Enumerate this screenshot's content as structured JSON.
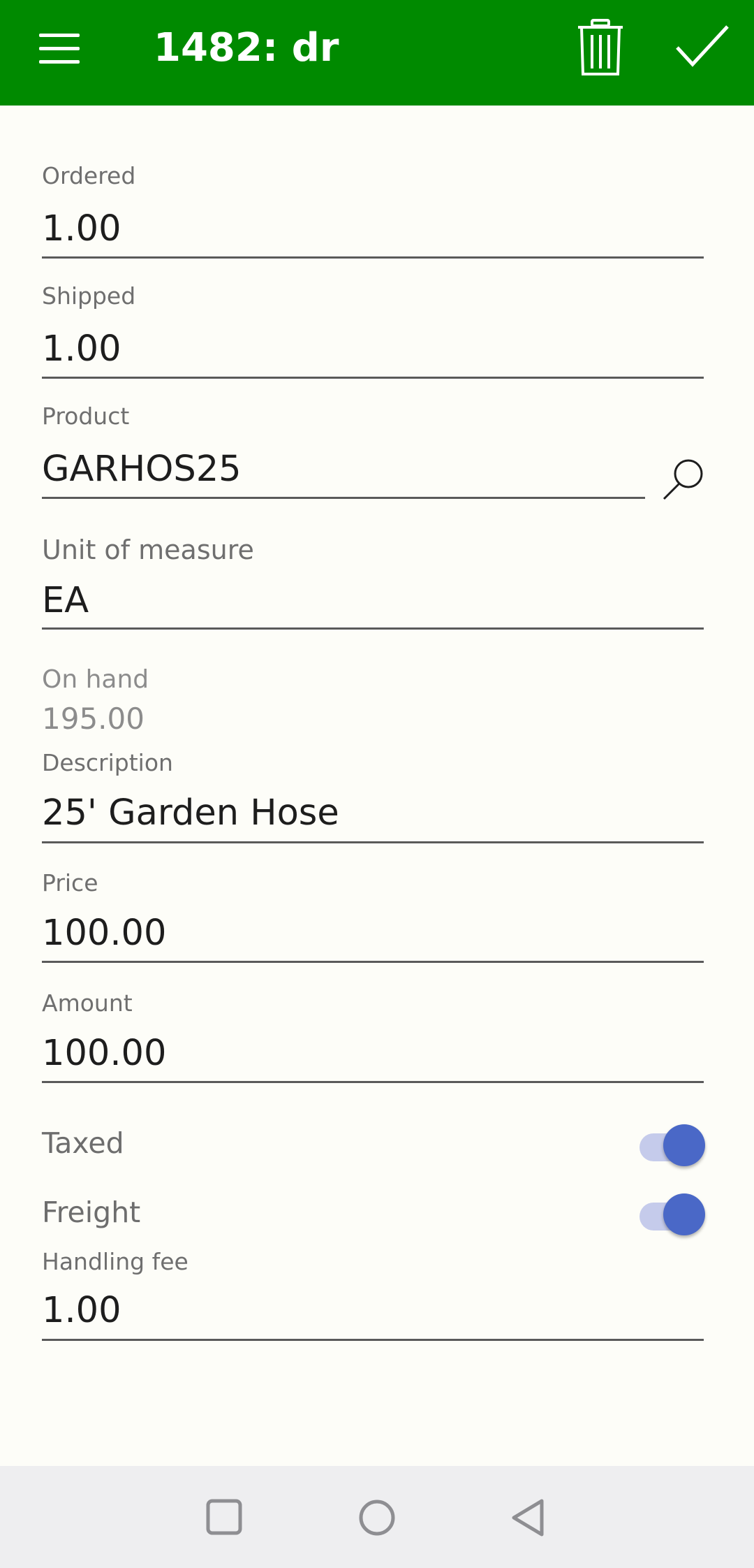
{
  "appbar": {
    "title": "1482: dr",
    "menu_icon": "menu-icon",
    "delete_icon": "trash-icon",
    "confirm_icon": "check-icon",
    "background": "#008a00"
  },
  "fields": {
    "ordered": {
      "label": "Ordered",
      "value": "1.00"
    },
    "shipped": {
      "label": "Shipped",
      "value": "1.00"
    },
    "product": {
      "label": "Product",
      "value": "GARHOS25"
    },
    "unit": {
      "label": "Unit of measure",
      "value": "EA"
    },
    "on_hand": {
      "label": "On hand",
      "value": "195.00"
    },
    "description": {
      "label": "Description",
      "value": "25' Garden Hose"
    },
    "price": {
      "label": "Price",
      "value": "100.00"
    },
    "amount": {
      "label": "Amount",
      "value": "100.00"
    },
    "handling_fee": {
      "label": "Handling fee",
      "value": "1.00"
    }
  },
  "toggles": {
    "taxed": {
      "label": "Taxed",
      "on": true
    },
    "freight": {
      "label": "Freight",
      "on": true
    }
  },
  "colors": {
    "accent": "#4a68c7",
    "background": "#fdfdf8"
  },
  "navbar": {
    "icons": [
      "recents-icon",
      "home-icon",
      "back-icon"
    ]
  }
}
